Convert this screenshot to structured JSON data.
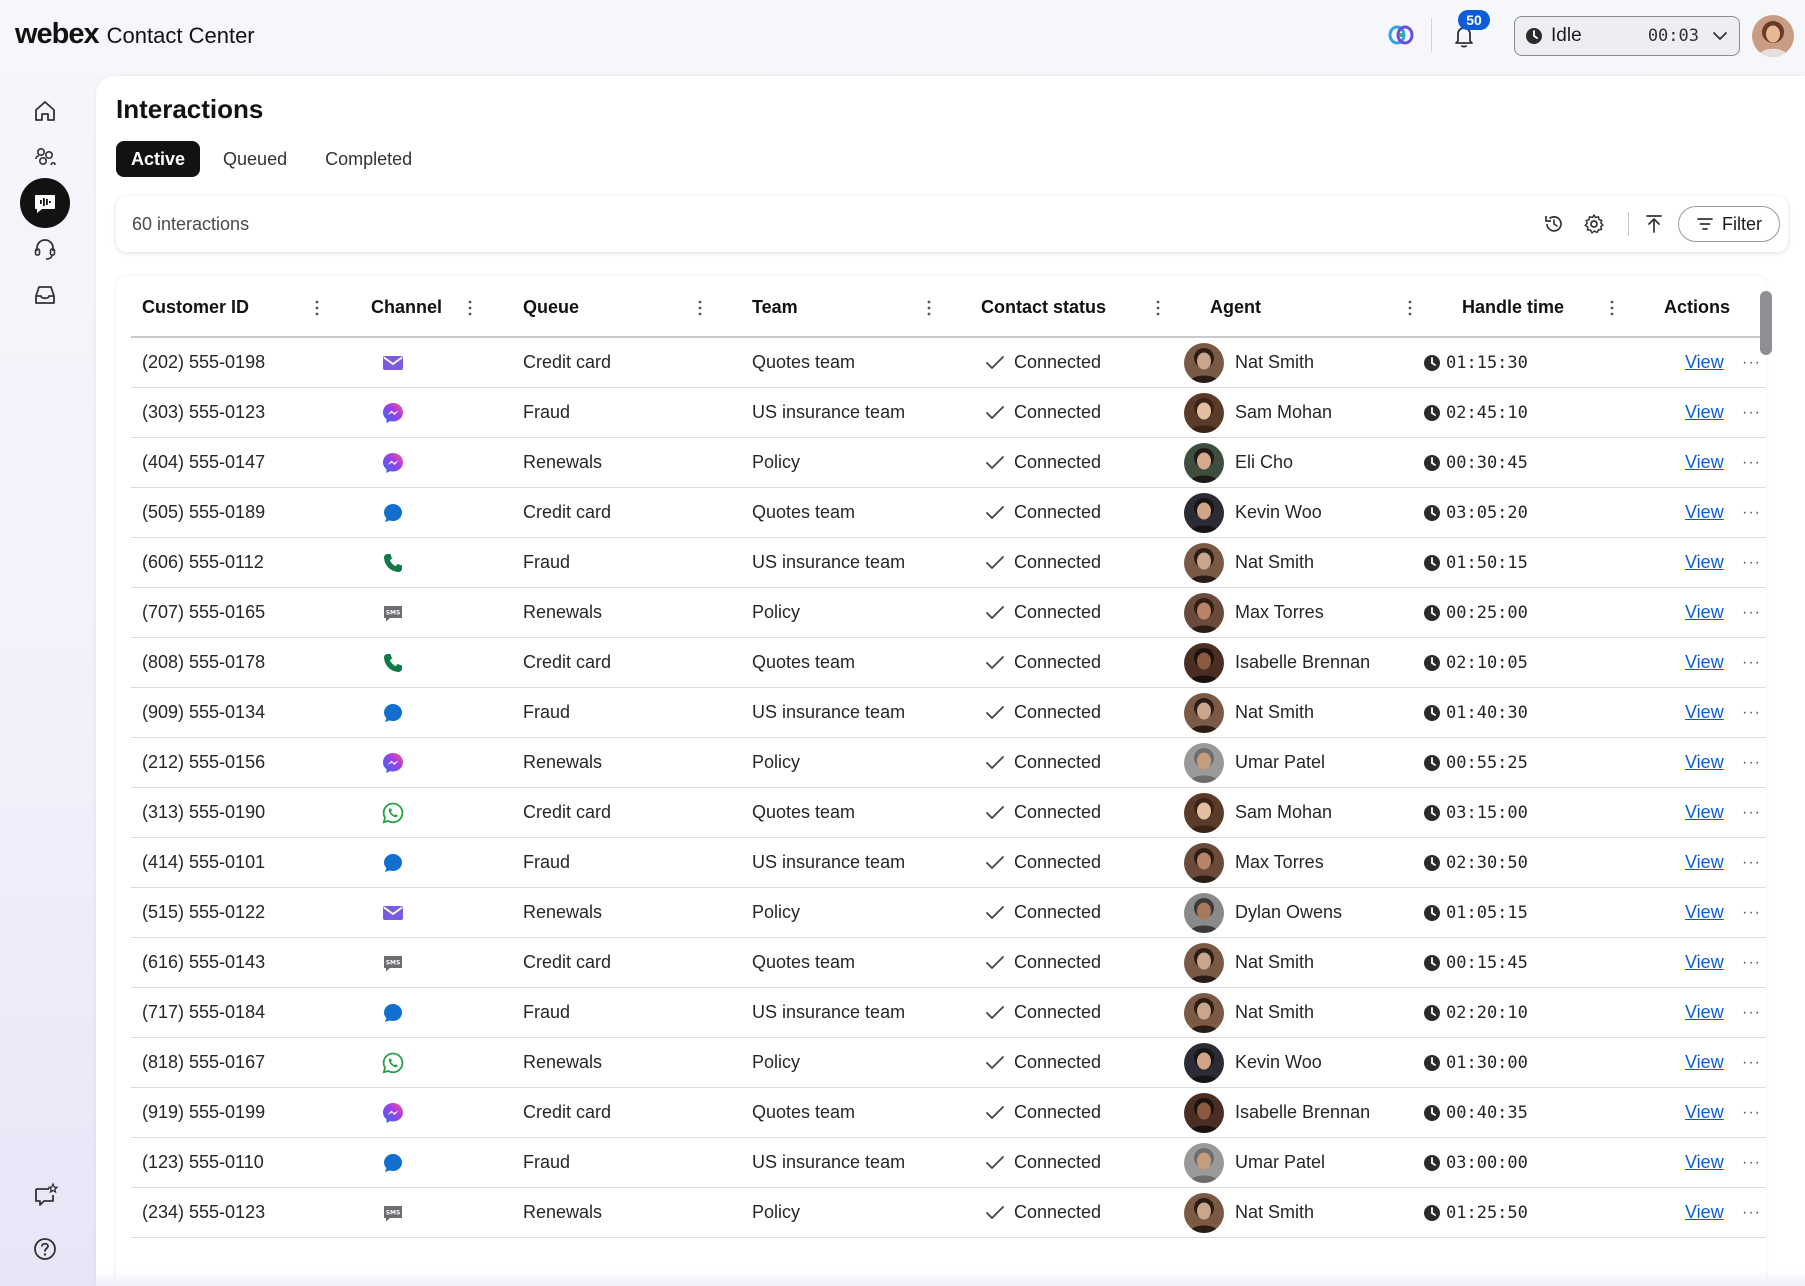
{
  "header": {
    "brand_logo": "webex",
    "brand_name": "Contact Center",
    "notification_count": "50",
    "agent_status": "Idle",
    "status_timer": "00:03"
  },
  "page": {
    "title": "Interactions",
    "tabs": [
      {
        "label": "Active",
        "active": true
      },
      {
        "label": "Queued",
        "active": false
      },
      {
        "label": "Completed",
        "active": false
      }
    ],
    "interaction_count": "60 interactions",
    "filter_label": "Filter"
  },
  "table": {
    "columns": [
      "Customer ID",
      "Channel",
      "Queue",
      "Team",
      "Contact status",
      "Agent",
      "Handle time",
      "Actions"
    ],
    "view_label": "View",
    "more_label": "···",
    "rows": [
      {
        "customer_id": "(202) 555-0198",
        "channel": "email-icon",
        "queue": "Credit card",
        "team": "Quotes team",
        "status": "Connected",
        "agent": "Nat Smith",
        "handle_time": "01:15:30"
      },
      {
        "customer_id": "(303) 555-0123",
        "channel": "messenger-icon",
        "queue": "Fraud",
        "team": "US insurance team",
        "status": "Connected",
        "agent": "Sam Mohan",
        "handle_time": "02:45:10"
      },
      {
        "customer_id": "(404) 555-0147",
        "channel": "messenger-icon",
        "queue": "Renewals",
        "team": "Policy",
        "status": "Connected",
        "agent": "Eli Cho",
        "handle_time": "00:30:45"
      },
      {
        "customer_id": "(505) 555-0189",
        "channel": "chat-icon",
        "queue": "Credit card",
        "team": "Quotes team",
        "status": "Connected",
        "agent": "Kevin Woo",
        "handle_time": "03:05:20"
      },
      {
        "customer_id": "(606) 555-0112",
        "channel": "phone-icon",
        "queue": "Fraud",
        "team": "US insurance team",
        "status": "Connected",
        "agent": "Nat Smith",
        "handle_time": "01:50:15"
      },
      {
        "customer_id": "(707) 555-0165",
        "channel": "sms-icon",
        "queue": "Renewals",
        "team": "Policy",
        "status": "Connected",
        "agent": "Max Torres",
        "handle_time": "00:25:00"
      },
      {
        "customer_id": "(808) 555-0178",
        "channel": "phone-icon",
        "queue": "Credit card",
        "team": "Quotes team",
        "status": "Connected",
        "agent": "Isabelle Brennan",
        "handle_time": "02:10:05"
      },
      {
        "customer_id": "(909) 555-0134",
        "channel": "chat-icon",
        "queue": "Fraud",
        "team": "US insurance team",
        "status": "Connected",
        "agent": "Nat Smith",
        "handle_time": "01:40:30"
      },
      {
        "customer_id": "(212) 555-0156",
        "channel": "messenger-icon",
        "queue": "Renewals",
        "team": "Policy",
        "status": "Connected",
        "agent": "Umar Patel",
        "handle_time": "00:55:25"
      },
      {
        "customer_id": "(313) 555-0190",
        "channel": "whatsapp-icon",
        "queue": "Credit card",
        "team": "Quotes team",
        "status": "Connected",
        "agent": "Sam Mohan",
        "handle_time": "03:15:00"
      },
      {
        "customer_id": "(414) 555-0101",
        "channel": "chat-icon",
        "queue": "Fraud",
        "team": "US insurance team",
        "status": "Connected",
        "agent": "Max Torres",
        "handle_time": "02:30:50"
      },
      {
        "customer_id": "(515) 555-0122",
        "channel": "email-icon",
        "queue": "Renewals",
        "team": "Policy",
        "status": "Connected",
        "agent": "Dylan Owens",
        "handle_time": "01:05:15"
      },
      {
        "customer_id": "(616) 555-0143",
        "channel": "sms-icon",
        "queue": "Credit card",
        "team": "Quotes team",
        "status": "Connected",
        "agent": "Nat Smith",
        "handle_time": "00:15:45"
      },
      {
        "customer_id": "(717) 555-0184",
        "channel": "chat-icon",
        "queue": "Fraud",
        "team": "US insurance team",
        "status": "Connected",
        "agent": "Nat Smith",
        "handle_time": "02:20:10"
      },
      {
        "customer_id": "(818) 555-0167",
        "channel": "whatsapp-icon",
        "queue": "Renewals",
        "team": "Policy",
        "status": "Connected",
        "agent": "Kevin Woo",
        "handle_time": "01:30:00"
      },
      {
        "customer_id": "(919) 555-0199",
        "channel": "messenger-icon",
        "queue": "Credit card",
        "team": "Quotes team",
        "status": "Connected",
        "agent": "Isabelle Brennan",
        "handle_time": "00:40:35"
      },
      {
        "customer_id": "(123) 555-0110",
        "channel": "chat-icon",
        "queue": "Fraud",
        "team": "US insurance team",
        "status": "Connected",
        "agent": "Umar Patel",
        "handle_time": "03:00:00"
      },
      {
        "customer_id": "(234) 555-0123",
        "channel": "sms-icon",
        "queue": "Renewals",
        "team": "Policy",
        "status": "Connected",
        "agent": "Nat Smith",
        "handle_time": "01:25:50"
      }
    ]
  },
  "colors": {
    "accent": "#0b5cd6",
    "email": "#7b5ce0",
    "chat": "#1170cf",
    "phone": "#0f7a45",
    "whatsapp": "#25a244",
    "sms": "#6b6b70"
  }
}
